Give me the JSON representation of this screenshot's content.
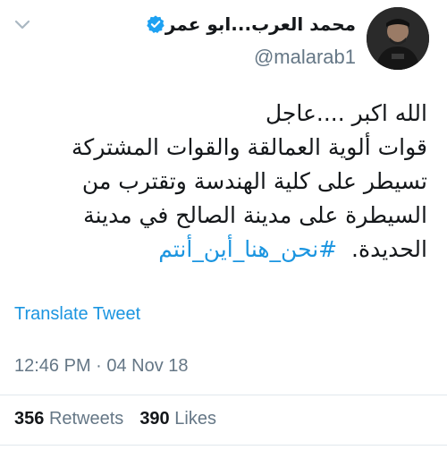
{
  "author": {
    "display_name": "محمد العرب...ابو عمر",
    "handle": "@malarab1",
    "verified": true
  },
  "tweet": {
    "lines": [
      "الله اكبر ....عاجل",
      "قوات ألوية العمالقة والقوات المشتركة",
      "تسيطر على كلية الهندسة وتقترب من",
      "السيطرة على مدينة الصالح في مدينة"
    ],
    "last_line_text": "الحديدة.",
    "hashtag": "#نحن_هنا_أين_أنتم"
  },
  "translate_label": "Translate Tweet",
  "timestamp": "12:46 PM · 04 Nov 18",
  "stats": {
    "retweets_count": "356",
    "retweets_label": "Retweets",
    "likes_count": "390",
    "likes_label": "Likes"
  },
  "colors": {
    "accent": "#1b95e0",
    "verified": "#1da1f2",
    "secondary_text": "#657786"
  },
  "icons": {
    "menu": "chevron-down-icon",
    "verified": "verified-badge-icon"
  }
}
